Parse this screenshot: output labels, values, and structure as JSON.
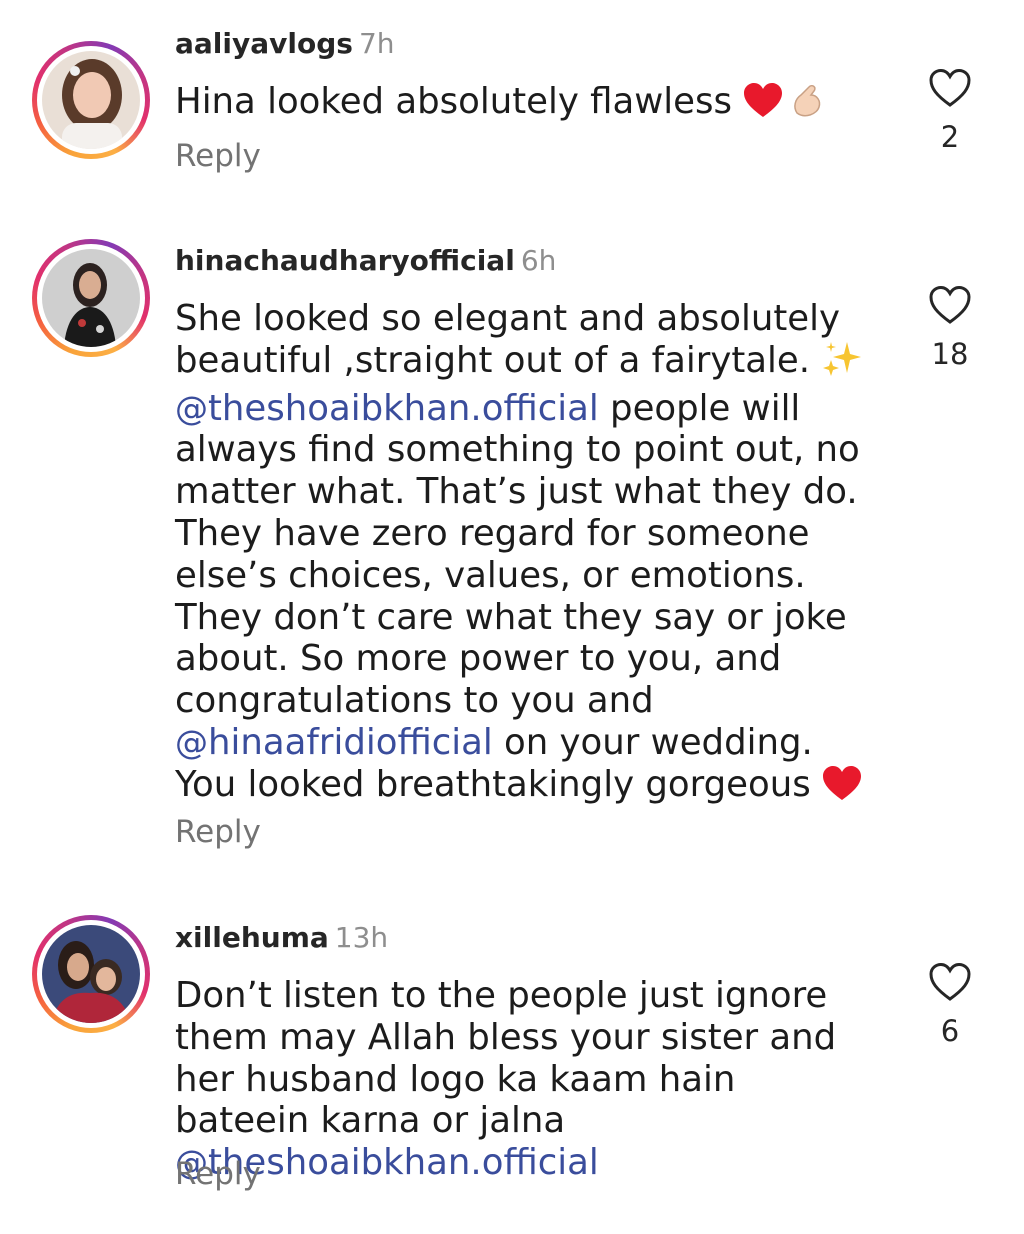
{
  "comments": [
    {
      "username": "aaliyavlogs",
      "time": "7h",
      "text_parts": [
        "Hina looked absolutely flawless "
      ],
      "emojis": [
        "red-heart",
        "pinched-fingers"
      ],
      "reply_label": "Reply",
      "like_count": "2"
    },
    {
      "username": "hinachaudharyofficial",
      "time": "6h",
      "text_1": "She looked so elegant and absolutely beautiful ,straight out of a fairytale. ",
      "mention_1": "theshoaibkhan.official",
      "text_2": " people will always find something to point out, no matter what. That’s just what they do. They have zero regard for someone else’s choices, values, or emotions. They don’t care what they say or joke about. So more power to you, and congratulations to you and ",
      "mention_2": "hinaafridiofficial",
      "text_3": " on your wedding. You looked breathtakingly gorgeous ",
      "emojis": [
        "sparkles",
        "red-heart"
      ],
      "reply_label": "Reply",
      "like_count": "18"
    },
    {
      "username": "xillehuma",
      "time": "13h",
      "text_1": "Don’t listen to the people just ignore them may Allah bless your sister and her husband logo ka kaam hain bateein karna or jalna ",
      "mention_1": "theshoaibkhan.official",
      "reply_label": "Reply",
      "like_count": "6"
    }
  ],
  "mention_symbol": "@",
  "colors": {
    "mention": "#3a4d9c",
    "secondary_text": "#737373",
    "heart_emoji": "#e8192c"
  }
}
